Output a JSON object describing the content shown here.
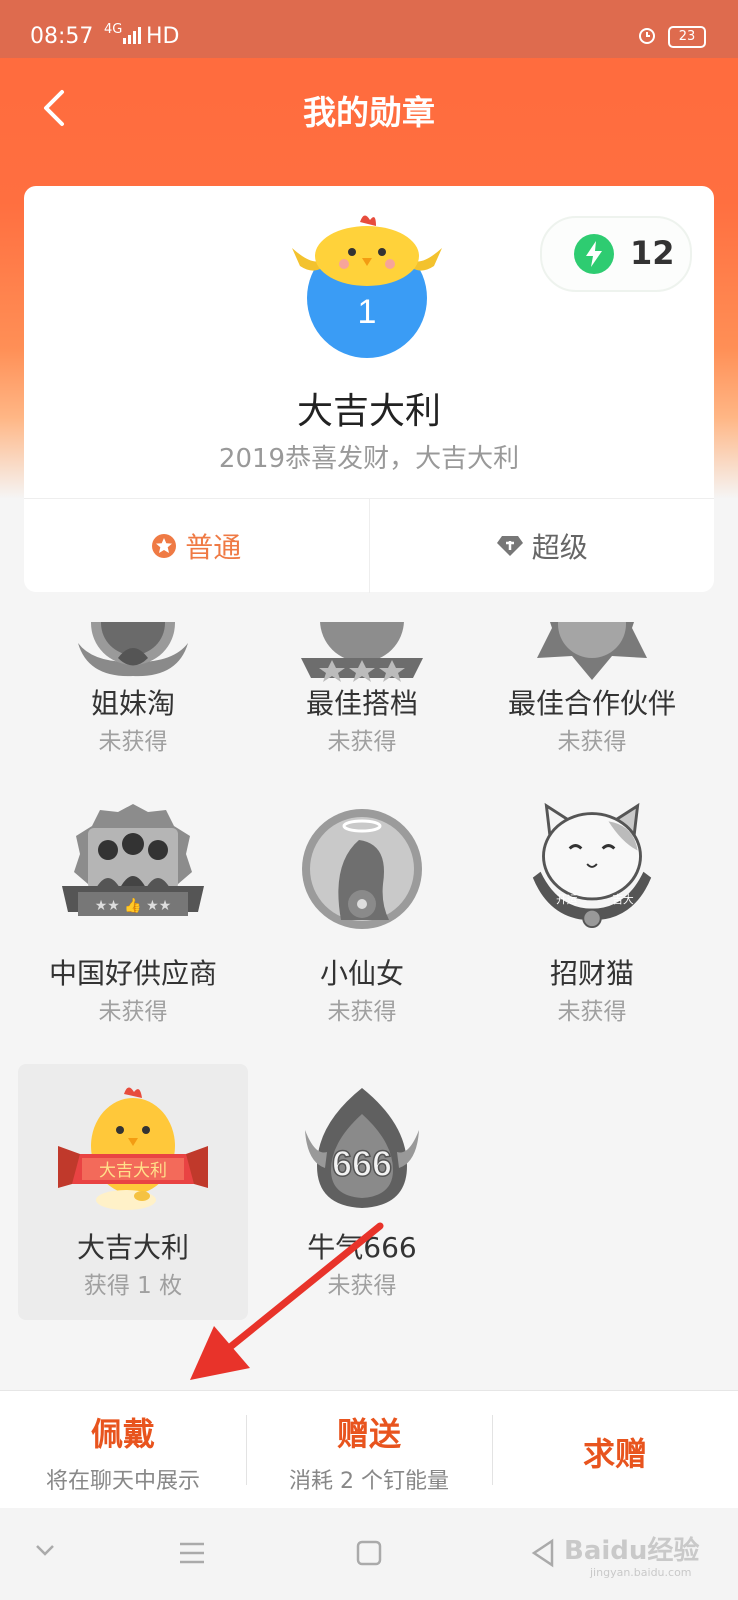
{
  "status_bar": {
    "time": "08:57",
    "network": "4G",
    "hd": "HD",
    "battery": "23"
  },
  "nav": {
    "title": "我的勋章"
  },
  "energy": {
    "count": "12"
  },
  "featured": {
    "level": "1",
    "name": "大吉大利",
    "desc": "2019恭喜发财，大吉大利"
  },
  "tabs": [
    {
      "label": "普通"
    },
    {
      "label": "超级"
    }
  ],
  "badges": [
    {
      "name": "姐妹淘",
      "status": "未获得"
    },
    {
      "name": "最佳搭档",
      "status": "未获得"
    },
    {
      "name": "最佳合作伙伴",
      "status": "未获得"
    },
    {
      "name": "中国好供应商",
      "status": "未获得"
    },
    {
      "name": "小仙女",
      "status": "未获得"
    },
    {
      "name": "招财猫",
      "status": "未获得"
    },
    {
      "name": "大吉大利",
      "status": "获得 1 枚"
    },
    {
      "name": "牛气666",
      "status": "未获得"
    }
  ],
  "badge_art_text": {
    "dajidali_banner": "大吉大利",
    "niuqi": "666",
    "cat_left": "开运",
    "cat_right": "吉大"
  },
  "actions": {
    "wear": {
      "label": "佩戴",
      "sub": "将在聊天中展示"
    },
    "gift": {
      "label": "赠送",
      "sub": "消耗 2 个钉能量"
    },
    "request": {
      "label": "求赠"
    }
  },
  "watermark": {
    "text": "Baidu经验",
    "sub": "jingyan.baidu.com"
  },
  "colors": {
    "accent": "#ff6a3d",
    "action": "#e8541e",
    "energy": "#2ecc71",
    "level_circle": "#3a9cf5"
  }
}
